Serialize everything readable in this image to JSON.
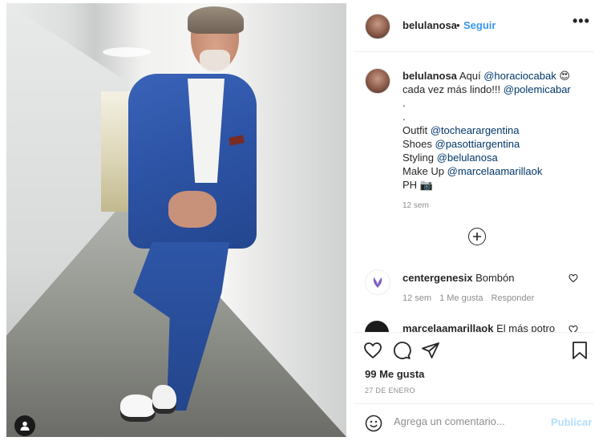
{
  "post": {
    "username": "belulanosa",
    "separator": "•",
    "follow_label": "Seguir",
    "more_label": "•••",
    "tag_user_icon": "user-icon"
  },
  "caption": {
    "username": "belulanosa",
    "line1_text": "Aquí",
    "line1_mention": "@horaciocabak",
    "line1_emoji": "😍",
    "line2_text": "cada vez más lindo!!!",
    "line2_mention": "@polemicabar",
    "dot1": ".",
    "dot2": ".",
    "outfit_label": "Outfit",
    "outfit_mention": "@tochearargentina",
    "shoes_label": "Shoes",
    "shoes_mention": "@pasottiargentina",
    "styling_label": "Styling",
    "styling_mention": "@belulanosa",
    "makeup_label": "Make Up",
    "makeup_mention": "@marcelaamarillaok",
    "ph_label": "PH",
    "ph_emoji": "📷",
    "time": "12 sem"
  },
  "comments": [
    {
      "username": "centergenesix",
      "text": "Bombón",
      "time": "12 sem",
      "likes": "1 Me gusta",
      "reply": "Responder"
    },
    {
      "username": "marcelaamarillaok",
      "text": "El más potro"
    }
  ],
  "actions": {
    "likes": "99 Me gusta",
    "date": "27 DE ENERO"
  },
  "add_comment": {
    "placeholder": "Agrega un comentario...",
    "post_label": "Publicar"
  },
  "colors": {
    "link": "#3897f0",
    "mention": "#00376b",
    "muted": "#8e8e8e",
    "disabled_post": "#b2dffc"
  }
}
